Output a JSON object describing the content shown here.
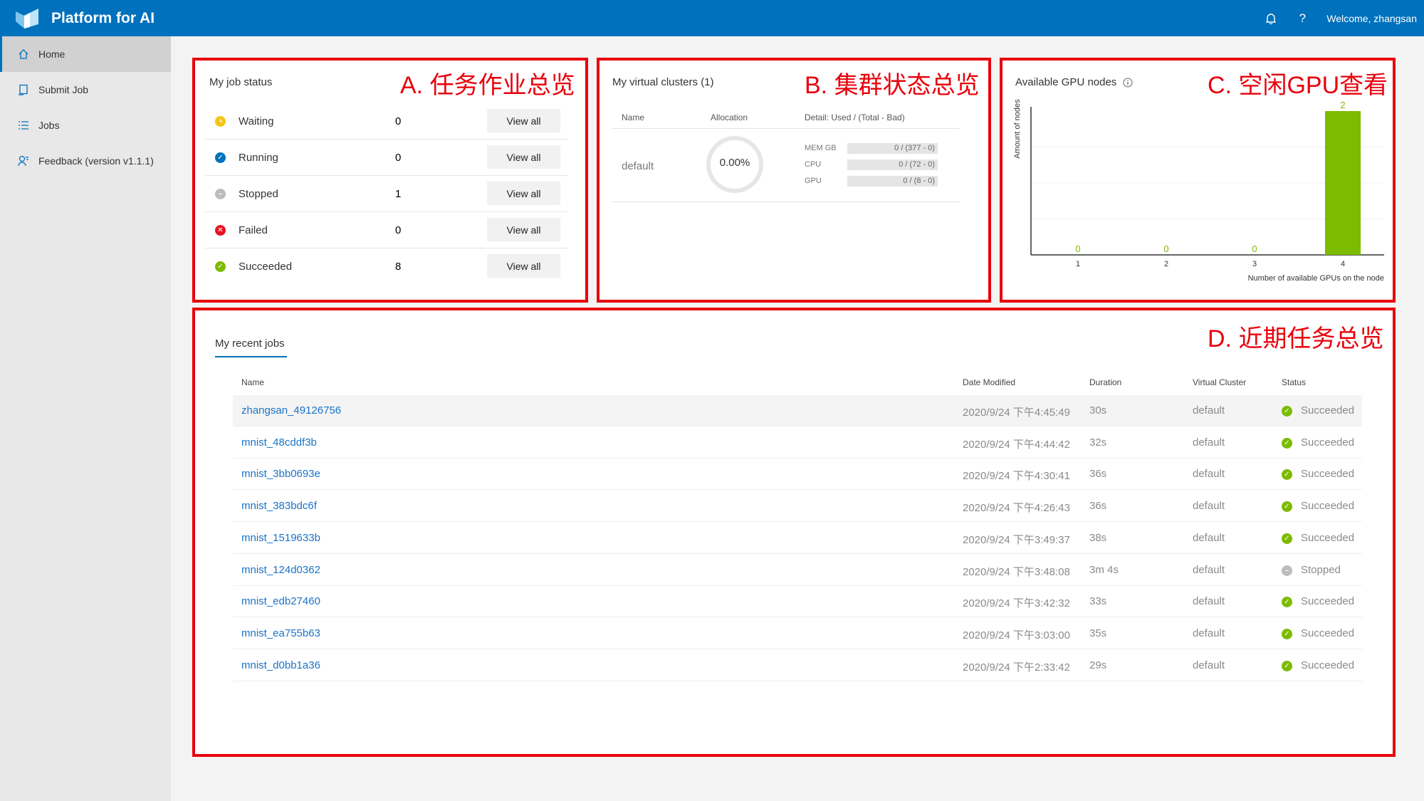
{
  "app": {
    "title": "Platform for AI",
    "welcome": "Welcome, zhangsan"
  },
  "sidebar": {
    "items": [
      {
        "label": "Home",
        "icon": "home-icon",
        "active": true
      },
      {
        "label": "Submit Job",
        "icon": "submit-icon"
      },
      {
        "label": "Jobs",
        "icon": "list-icon"
      },
      {
        "label": "Feedback (version v1.1.1)",
        "icon": "feedback-icon"
      }
    ]
  },
  "annotations": {
    "a": "A. 任务作业总览",
    "b": "B. 集群状态总览",
    "c": "C. 空闲GPU查看",
    "d": "D. 近期任务总览"
  },
  "job_status": {
    "title": "My job status",
    "view_all": "View all",
    "rows": [
      {
        "label": "Waiting",
        "count": "0",
        "color": "#f5c518"
      },
      {
        "label": "Running",
        "count": "0",
        "color": "#0071bc"
      },
      {
        "label": "Stopped",
        "count": "1",
        "color": "#bdbdbd"
      },
      {
        "label": "Failed",
        "count": "0",
        "color": "#e81123"
      },
      {
        "label": "Succeeded",
        "count": "8",
        "color": "#7cbb00"
      }
    ]
  },
  "virtual_clusters": {
    "title": "My virtual clusters (1)",
    "headers": {
      "name": "Name",
      "allocation": "Allocation",
      "detail": "Detail: Used / (Total - Bad)"
    },
    "rows": [
      {
        "name": "default",
        "allocation": "0.00%",
        "resources": [
          {
            "label": "MEM GB",
            "value": "0 / (377 - 0)"
          },
          {
            "label": "CPU",
            "value": "0 / (72 - 0)"
          },
          {
            "label": "GPU",
            "value": "0 / (8 - 0)"
          }
        ]
      }
    ]
  },
  "gpu_nodes": {
    "title": "Available GPU nodes",
    "chart_data": {
      "type": "bar",
      "categories": [
        "1",
        "2",
        "3",
        "4"
      ],
      "values": [
        0,
        0,
        0,
        2
      ],
      "xlabel": "Number of available GPUs on the node",
      "ylabel": "Amount of nodes",
      "ylim": [
        0,
        2
      ],
      "color": "#7cbb00"
    }
  },
  "recent_jobs": {
    "tab": "My recent jobs",
    "columns": [
      "Name",
      "Date Modified",
      "Duration",
      "Virtual Cluster",
      "Status"
    ],
    "rows": [
      {
        "name": "zhangsan_49126756",
        "date": "2020/9/24 下午4:45:49",
        "duration": "30s",
        "vc": "default",
        "status": "Succeeded"
      },
      {
        "name": "mnist_48cddf3b",
        "date": "2020/9/24 下午4:44:42",
        "duration": "32s",
        "vc": "default",
        "status": "Succeeded"
      },
      {
        "name": "mnist_3bb0693e",
        "date": "2020/9/24 下午4:30:41",
        "duration": "36s",
        "vc": "default",
        "status": "Succeeded"
      },
      {
        "name": "mnist_383bdc6f",
        "date": "2020/9/24 下午4:26:43",
        "duration": "36s",
        "vc": "default",
        "status": "Succeeded"
      },
      {
        "name": "mnist_1519633b",
        "date": "2020/9/24 下午3:49:37",
        "duration": "38s",
        "vc": "default",
        "status": "Succeeded"
      },
      {
        "name": "mnist_124d0362",
        "date": "2020/9/24 下午3:48:08",
        "duration": "3m 4s",
        "vc": "default",
        "status": "Stopped"
      },
      {
        "name": "mnist_edb27460",
        "date": "2020/9/24 下午3:42:32",
        "duration": "33s",
        "vc": "default",
        "status": "Succeeded"
      },
      {
        "name": "mnist_ea755b63",
        "date": "2020/9/24 下午3:03:00",
        "duration": "35s",
        "vc": "default",
        "status": "Succeeded"
      },
      {
        "name": "mnist_d0bb1a36",
        "date": "2020/9/24 下午2:33:42",
        "duration": "29s",
        "vc": "default",
        "status": "Succeeded"
      }
    ]
  }
}
